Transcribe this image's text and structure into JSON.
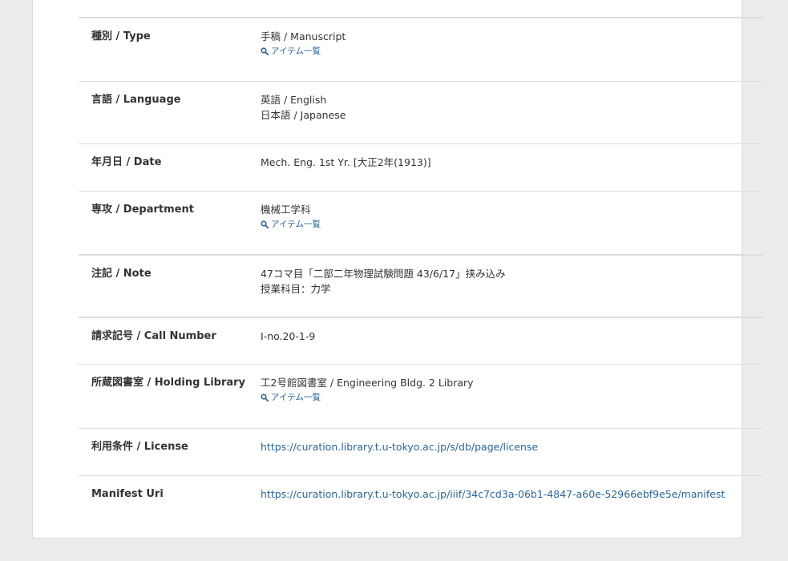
{
  "item_link_label": "アイテム一覧",
  "fields": [
    {
      "label": "種別 / Type",
      "values": [
        "手稿 / Manuscript"
      ],
      "has_item_link": true
    },
    {
      "label": "言語 / Language",
      "values": [
        "英語 / English",
        "日本語 / Japanese"
      ],
      "has_item_link": false
    },
    {
      "label": "年月日 / Date",
      "values": [
        "Mech. Eng. 1st Yr. [大正2年(1913)]"
      ],
      "has_item_link": false
    },
    {
      "label": "専攻 / Department",
      "values": [
        "機械工学科"
      ],
      "has_item_link": true
    },
    {
      "label": "注記 / Note",
      "values": [
        "47コマ目「二部二年物理試験問題 43/6/17」挟み込み",
        "授業科目：力学"
      ],
      "has_item_link": false
    },
    {
      "label": "請求記号 / Call Number",
      "values": [
        "I-no.20-1-9"
      ],
      "has_item_link": false
    },
    {
      "label": "所蔵図書室 / Holding Library",
      "values": [
        "工2号館図書室 / Engineering Bldg. 2 Library"
      ],
      "has_item_link": true
    },
    {
      "label": "利用条件 / License",
      "link": "https://curation.library.t.u-tokyo.ac.jp/s/db/page/license"
    },
    {
      "label": "Manifest Uri",
      "link": "https://curation.library.t.u-tokyo.ac.jp/iiif/34c7cd3a-06b1-4847-a60e-52966ebf9e5e/manifest"
    }
  ]
}
